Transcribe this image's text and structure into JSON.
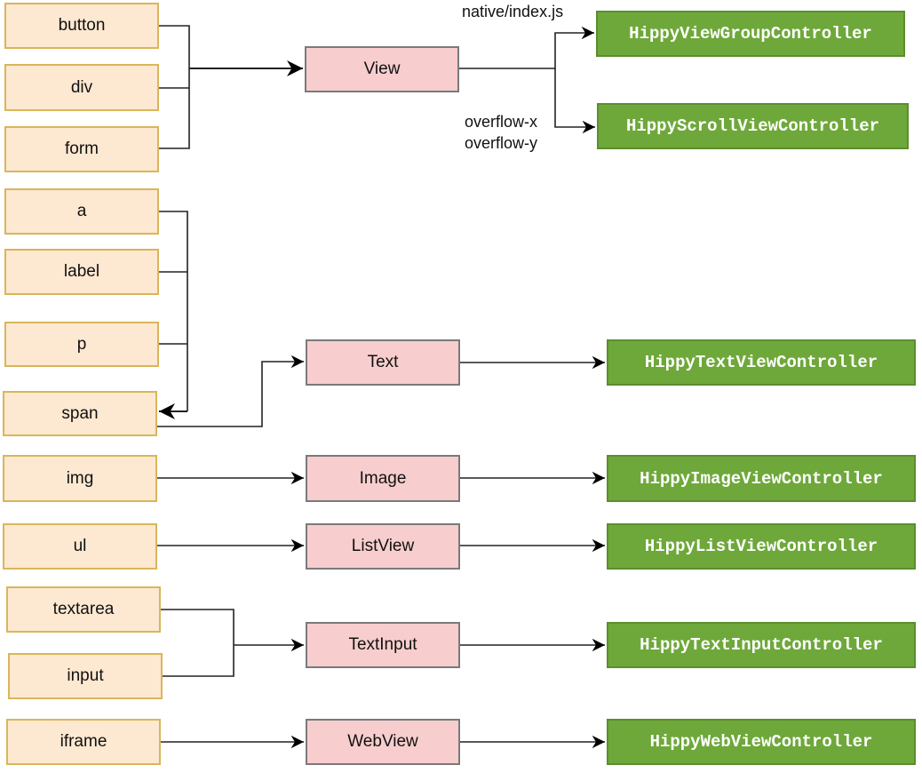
{
  "html_elements": [
    "button",
    "div",
    "form",
    "a",
    "label",
    "p",
    "span",
    "img",
    "ul",
    "textarea",
    "input",
    "iframe"
  ],
  "components": [
    "View",
    "Text",
    "Image",
    "ListView",
    "TextInput",
    "WebView"
  ],
  "controllers": [
    "HippyViewGroupController",
    "HippyScrollViewController",
    "HippyTextViewController",
    "HippyImageViewController",
    "HippyListViewController",
    "HippyTextInputController",
    "HippyWebViewController"
  ],
  "edge_labels": {
    "native": "native/index.js",
    "overflow_x": "overflow-x",
    "overflow_y": "overflow-y"
  },
  "colors": {
    "html_fill": "#fde8d1",
    "html_border": "#d9b659",
    "component_fill": "#f7cdcd",
    "controller_fill": "#6ea83a"
  }
}
